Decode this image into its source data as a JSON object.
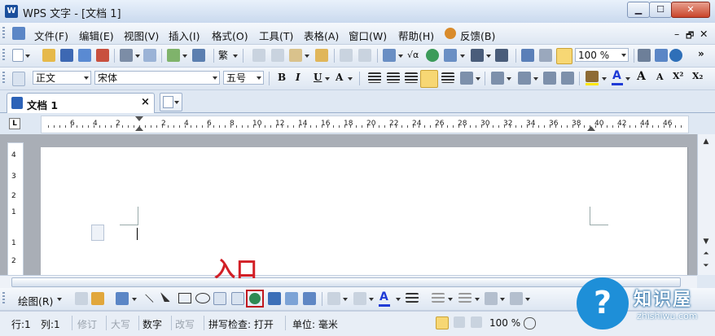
{
  "window": {
    "title": "WPS 文字 - [文档 1]",
    "app_icon_letter": "W",
    "minimize_glyph": "▁",
    "maximize_glyph": "☐",
    "close_glyph": "✕"
  },
  "menu": {
    "items": [
      "文件(F)",
      "编辑(E)",
      "视图(V)",
      "插入(I)",
      "格式(O)",
      "工具(T)",
      "表格(A)",
      "窗口(W)",
      "帮助(H)",
      "反馈(B)"
    ],
    "right_controls": [
      "–",
      "🗗",
      "✕"
    ]
  },
  "toolbar1": {
    "zoom_value": "100 %",
    "more_glyph": "»"
  },
  "toolbar2": {
    "style_value": "正文",
    "font_value": "宋体",
    "size_value": "五号",
    "bold": "B",
    "italic": "I",
    "underline": "U",
    "font_grow": "A",
    "font_shrink": "A",
    "superscript": "X²",
    "subscript": "X₂",
    "font_color_letter": "A",
    "font_color": "#1f3bd6",
    "highlight_color": "#ffe600"
  },
  "tabs": {
    "doc_tab_label": "文档 1",
    "close_glyph": "×"
  },
  "ruler": {
    "corner_label": "L",
    "h_ticks": [
      "6",
      "4",
      "2",
      "2",
      "4",
      "6",
      "8",
      "10",
      "12",
      "14",
      "16",
      "18",
      "20",
      "22",
      "24",
      "26",
      "28",
      "30",
      "32",
      "34",
      "36",
      "38",
      "40",
      "42",
      "44",
      "46"
    ],
    "v_ticks": [
      "4",
      "3",
      "2",
      "1",
      "1",
      "2"
    ]
  },
  "drawing_toolbar": {
    "label": "绘图(R)",
    "entry_annotation": "入口"
  },
  "statusbar": {
    "row": "行:1",
    "col": "列:1",
    "revise": "修订",
    "caps": "大写",
    "num": "数字",
    "overwrite": "改写",
    "spellcheck": "拼写检查: 打开",
    "unit": "单位: 毫米",
    "zoom": "100 %"
  },
  "watermark": {
    "title": "知识屋",
    "url": "zhishiwu.com",
    "brand_color": "#1e8fd8"
  }
}
